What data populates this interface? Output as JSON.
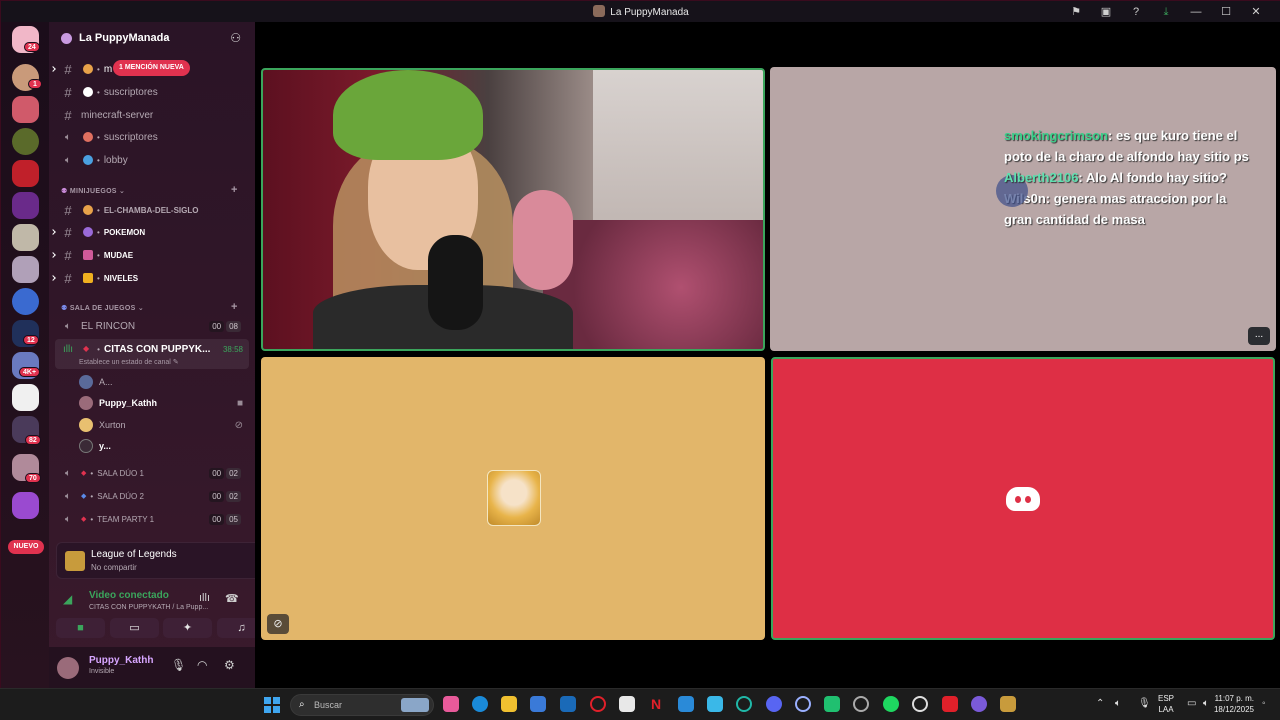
{
  "window": {
    "title": "La PuppyManada"
  },
  "rail": {
    "badges": [
      "24",
      "1",
      "12",
      "4K+",
      "82",
      "70"
    ],
    "new_pill": "NUEVO"
  },
  "sidebar": {
    "guild_name": "La PuppyManada",
    "mention_pill": "1 MENCIÓN NUEVA",
    "channels_top": [
      {
        "name": "m",
        "type": "text"
      },
      {
        "name": "suscriptores",
        "type": "text"
      },
      {
        "name": "minecraft-server",
        "type": "text"
      },
      {
        "name": "suscriptores",
        "type": "voice"
      },
      {
        "name": "lobby",
        "type": "voice"
      }
    ],
    "cat_minijuegos": "MINIJUEGOS",
    "channels_mini": [
      "EL-CHAMBA-DEL-SIGLO",
      "POKEMON",
      "MUDAE",
      "NIVELES"
    ],
    "cat_sala": "SALA DE JUEGOS",
    "rincon": {
      "name": "EL RINCON",
      "c1": "00",
      "c2": "08"
    },
    "citas": {
      "name": "CITAS CON PUPPYK...",
      "time": "38:58",
      "status": "Establece un estado de canal"
    },
    "users": [
      "A...",
      "Puppy_Kathh",
      "Xurton",
      "y..."
    ],
    "salas": [
      {
        "name": "SALA DÚO 1",
        "c1": "00",
        "c2": "02"
      },
      {
        "name": "SALA DÚO 2",
        "c1": "00",
        "c2": "02"
      },
      {
        "name": "TEAM PARTY 1",
        "c1": "00",
        "c2": "05"
      }
    ]
  },
  "activity": {
    "game": "League of Legends",
    "status": "No compartir"
  },
  "voice": {
    "title": "Video conectado",
    "channel": "CITAS CON PUPPYKATH / La Pupp..."
  },
  "user": {
    "name": "Puppy_Kathh",
    "status": "Invisible"
  },
  "stage": {
    "chat": [
      {
        "user": "smokingcrimson",
        "text": ": es que kuro tiene el poto de la charo de alfondo hay sitio ps"
      },
      {
        "user": "Alberth2106",
        "text": ": Alo Al fondo hay sitio?"
      },
      {
        "user": "Wils0n",
        "text": ": genera mas atraccion por la gran cantidad de masa"
      }
    ],
    "more": "..."
  },
  "taskbar": {
    "search_placeholder": "Buscar",
    "lang1": "ESP",
    "lang2": "LAA",
    "time": "11:07 p. m.",
    "date": "18/12/2025"
  },
  "colors": {
    "accent_green": "#3ba55c",
    "mention_red": "#e0324f",
    "tile_red": "#de2f45",
    "tile_yellow": "#e2b66a"
  }
}
